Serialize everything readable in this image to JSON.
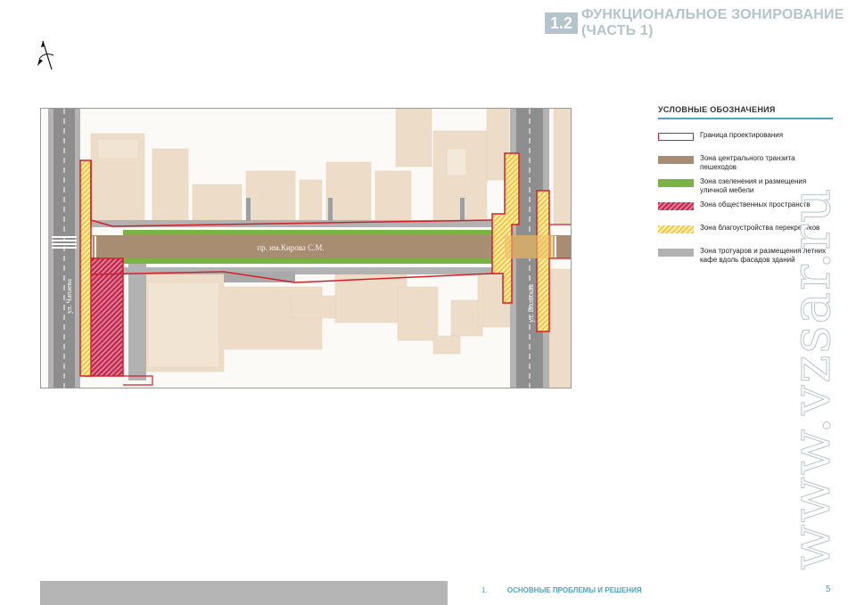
{
  "header": {
    "number": "1.2",
    "title": "ФУНКЦИОНАЛЬНОЕ ЗОНИРОВАНИЕ (ЧАСТЬ 1)"
  },
  "map": {
    "street_main": "пр. им.Кирова С.М.",
    "street_left": "ул. Чапаева",
    "street_right": "ул. Вольская"
  },
  "legend": {
    "title": "УСЛОВНЫЕ ОБОЗНАЧЕНИЯ",
    "items": [
      {
        "label": "Граница проектирования",
        "color": "#d41f2a"
      },
      {
        "label": "Зона центрального транзита пешеходов",
        "color": "#a88d72"
      },
      {
        "label": "Зона озеленения и размещения уличной мебели",
        "color": "#79b245"
      },
      {
        "label": "Зона общественных пространств",
        "color": "#c02a4e"
      },
      {
        "label": "Зона благоустройства перекрестков",
        "color": "#f2c84c"
      },
      {
        "label": "Зона тротуаров и размещения летних кафе вдоль фасадов зданий",
        "color": "#b1b2b1"
      }
    ]
  },
  "footer": {
    "section_number": "1.",
    "section_title": "ОСНОВНЫЕ ПРОБЛЕМЫ И РЕШЕНИЯ",
    "page": "5"
  },
  "watermark": "www.vzsar.ru"
}
